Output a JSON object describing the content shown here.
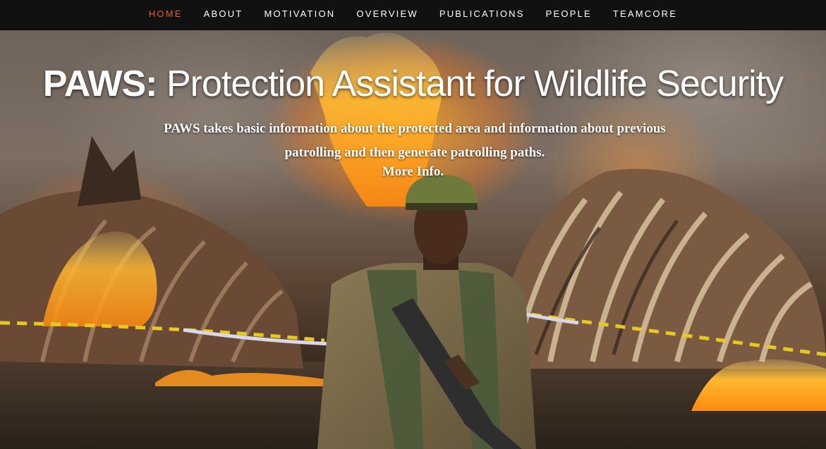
{
  "nav": {
    "items": [
      {
        "label": "HOME",
        "active": true
      },
      {
        "label": "ABOUT",
        "active": false
      },
      {
        "label": "MOTIVATION",
        "active": false
      },
      {
        "label": "OVERVIEW",
        "active": false
      },
      {
        "label": "PUBLICATIONS",
        "active": false
      },
      {
        "label": "PEOPLE",
        "active": false
      },
      {
        "label": "TEAMCORE",
        "active": false
      }
    ],
    "active_color": "#e8632a",
    "background": "#111111"
  },
  "hero": {
    "title_strong": "PAWS:",
    "title_rest": " Protection Assistant for Wildlife Security",
    "description": "PAWS takes basic information about the protected area and information about previous patrolling and then generate patrolling paths.",
    "more_info_link": "More Info."
  }
}
